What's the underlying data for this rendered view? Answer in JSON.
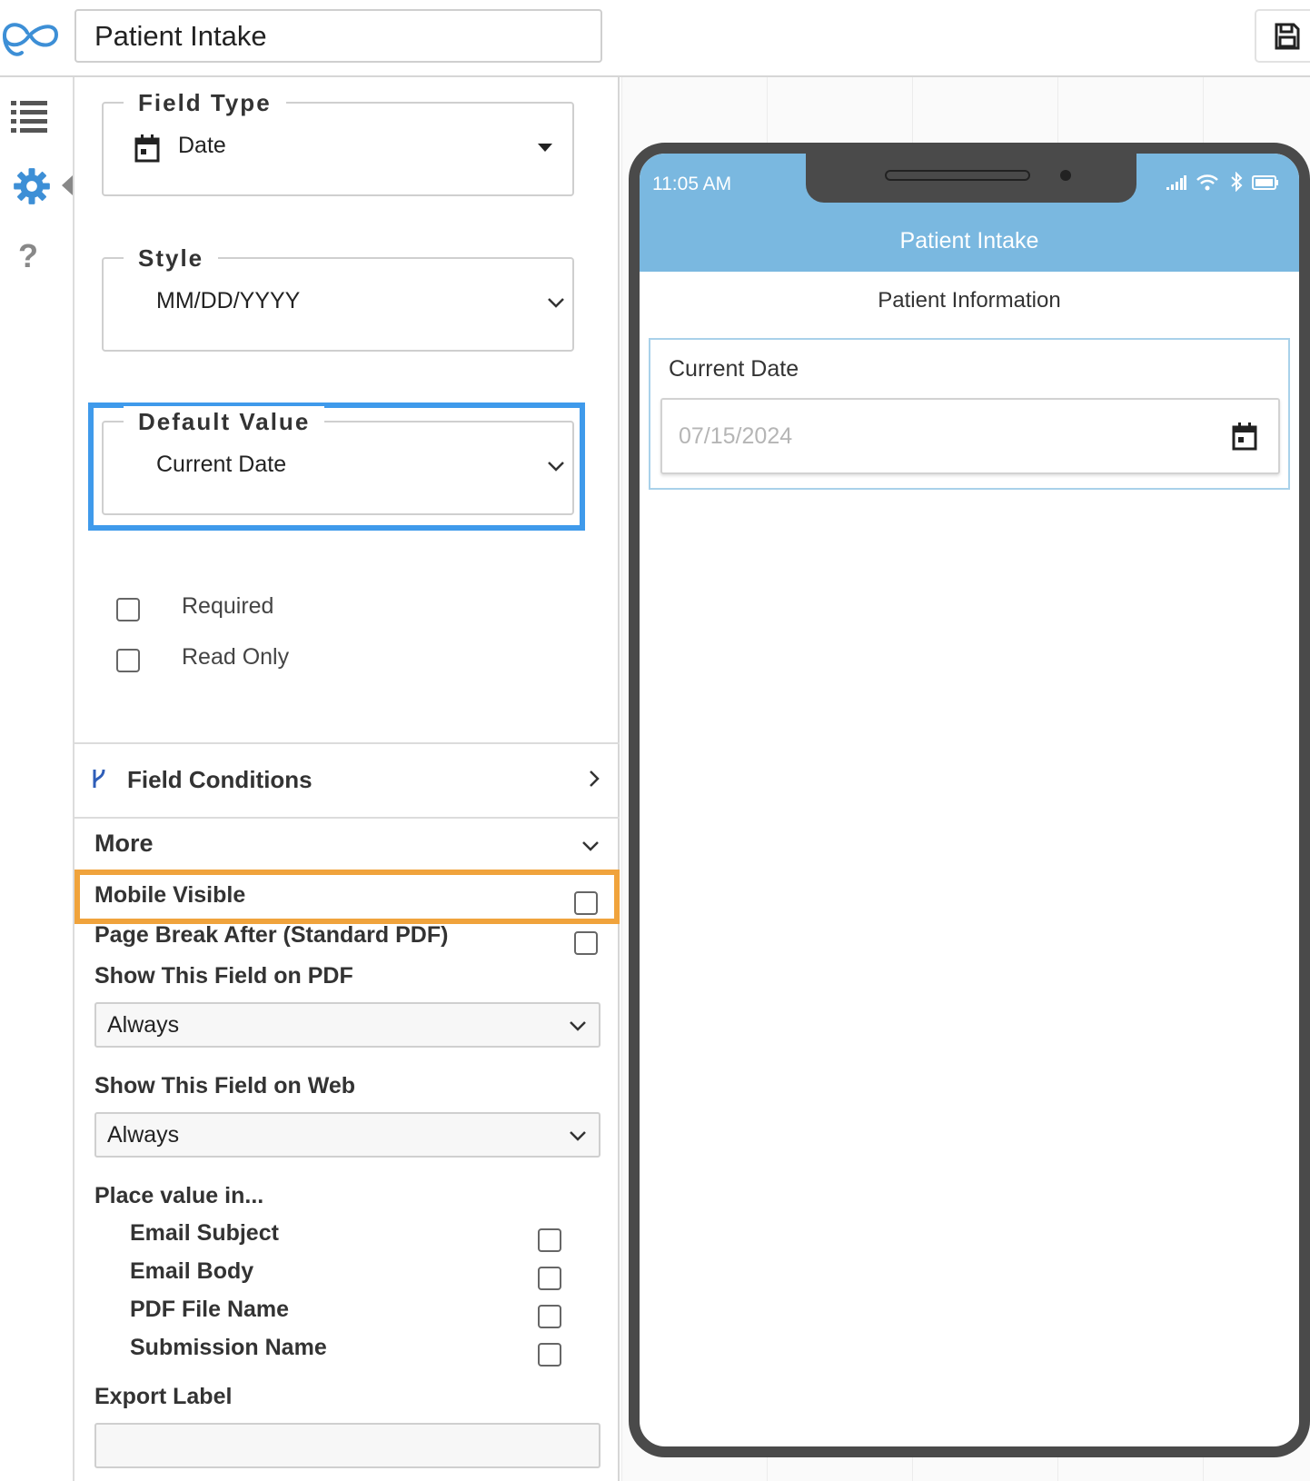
{
  "app": {
    "form_title": "Patient Intake"
  },
  "settings": {
    "field_type": {
      "legend": "Field Type",
      "value": "Date"
    },
    "style": {
      "legend": "Style",
      "value": "MM/DD/YYYY"
    },
    "default_value": {
      "legend": "Default Value",
      "value": "Current Date"
    },
    "checkboxes": [
      {
        "label": "Required",
        "checked": false
      },
      {
        "label": "Read Only",
        "checked": false
      }
    ],
    "field_conditions_label": "Field Conditions",
    "more_label": "More",
    "mobile_visible_label": "Mobile Visible",
    "page_break_label": "Page Break After (Standard PDF)",
    "show_pdf_label": "Show This Field on PDF",
    "show_pdf_value": "Always",
    "show_web_label": "Show This Field on Web",
    "show_web_value": "Always",
    "place_value_label": "Place value in...",
    "place_value_items": [
      {
        "label": "Email Subject"
      },
      {
        "label": "Email Body"
      },
      {
        "label": "PDF File Name"
      },
      {
        "label": "Submission Name"
      }
    ],
    "export_label": "Export Label",
    "export_value": ""
  },
  "phone": {
    "status_time": "11:05 AM",
    "header_title": "Patient Intake",
    "section_title": "Patient Information",
    "field_label": "Current Date",
    "date_placeholder": "07/15/2024"
  },
  "colors": {
    "highlight_blue": "#3f9aeb",
    "highlight_orange": "#f0a33c",
    "phone_header": "#7ab8e0",
    "accent_icon": "#3d8fd6"
  },
  "icons": {
    "logo": "go-infinity-logo",
    "save": "floppy-disk-icon",
    "list": "list-icon",
    "gear": "gear-icon",
    "help": "question-icon",
    "calendar": "calendar-icon",
    "branch": "branch-icon"
  }
}
